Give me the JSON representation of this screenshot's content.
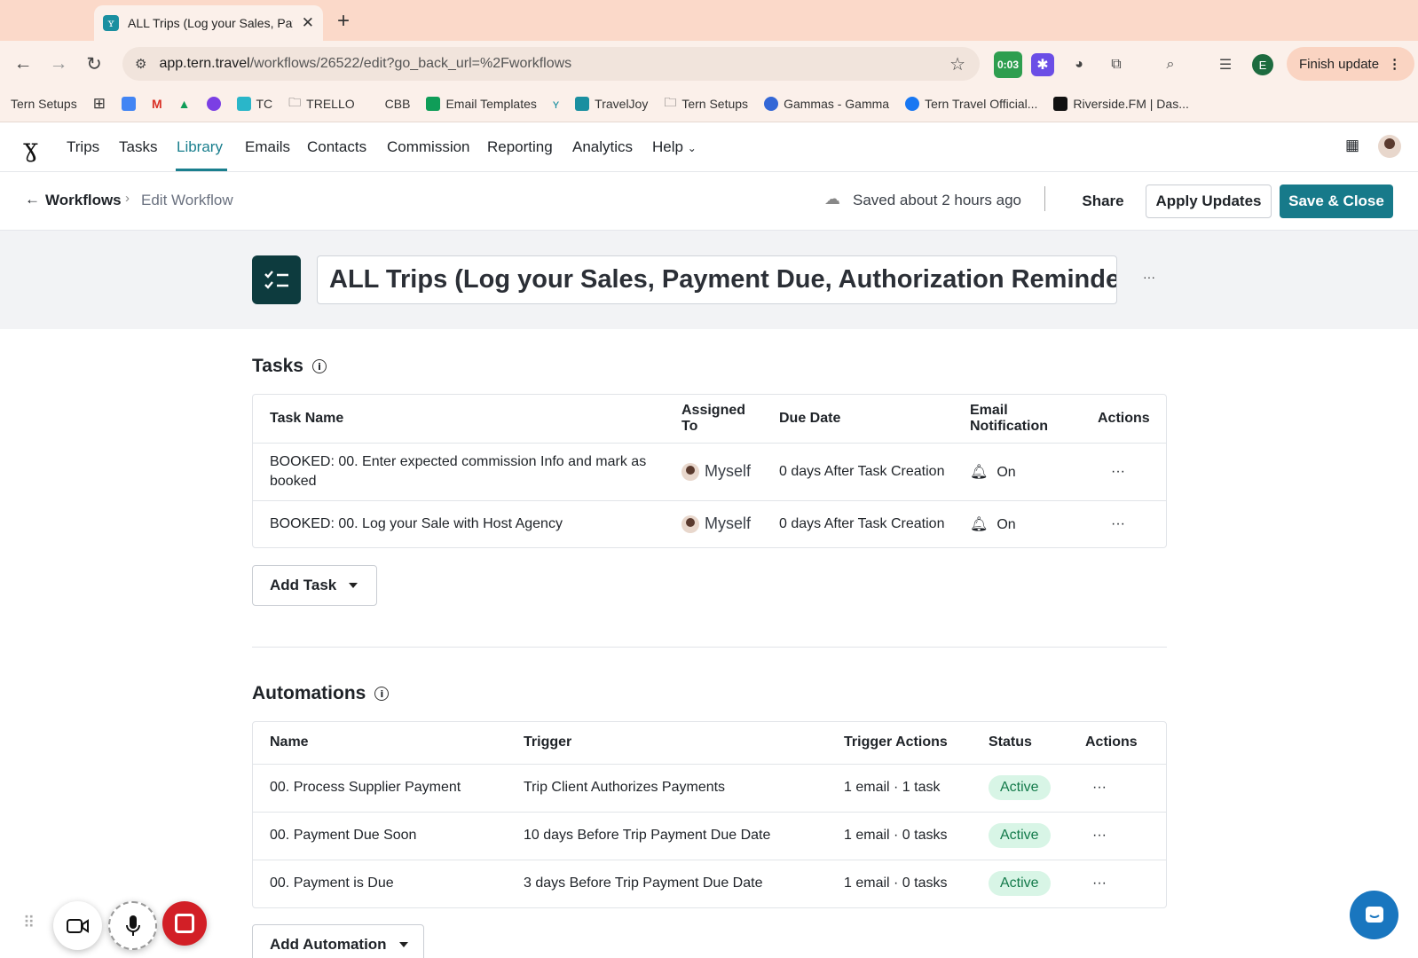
{
  "browser": {
    "tab_title": "ALL Trips (Log your Sales, Pay",
    "url_host": "app.tern.travel",
    "url_path": "/workflows/26522/edit?go_back_url=%2Fworkflows",
    "ext_timer": "0:03",
    "finish_update": "Finish update",
    "profile_initial": "E",
    "bookmarks": [
      "Tern Setups",
      "TC",
      "TRELLO",
      "CBB",
      "Email Templates",
      "TravelJoy",
      "Tern Setups",
      "Gammas - Gamma",
      "Tern Travel Official...",
      "Riverside.FM | Das..."
    ]
  },
  "nav": {
    "items": [
      "Trips",
      "Tasks",
      "Library",
      "Emails",
      "Contacts",
      "Commission",
      "Reporting",
      "Analytics",
      "Help"
    ],
    "active": "Library"
  },
  "subheader": {
    "back_label": "Workflows",
    "current": "Edit Workflow",
    "saved_status": "Saved about 2 hours ago",
    "share": "Share",
    "apply": "Apply Updates",
    "save_close": "Save & Close"
  },
  "workflow_title": "ALL Trips (Log your Sales, Payment Due, Authorization Reminders)",
  "more_glyph": "···",
  "tasks": {
    "heading": "Tasks",
    "columns": [
      "Task Name",
      "Assigned To",
      "Due Date",
      "Email Notification",
      "Actions"
    ],
    "rows": [
      {
        "name": "BOOKED: 00. Enter expected commission Info and mark as booked",
        "assigned": "Myself",
        "due": "0 days After Task Creation",
        "notification": "On"
      },
      {
        "name": "BOOKED: 00. Log your Sale with Host Agency",
        "assigned": "Myself",
        "due": "0 days After Task Creation",
        "notification": "On"
      }
    ],
    "add_label": "Add Task"
  },
  "automations": {
    "heading": "Automations",
    "columns": [
      "Name",
      "Trigger",
      "Trigger Actions",
      "Status",
      "Actions"
    ],
    "rows": [
      {
        "name": "00. Process Supplier Payment",
        "trigger": "Trip Client Authorizes Payments",
        "actions": "1 email · 1 task",
        "status": "Active"
      },
      {
        "name": "00. Payment Due Soon",
        "trigger": "10 days Before Trip Payment Due Date",
        "actions": "1 email · 0 tasks",
        "status": "Active"
      },
      {
        "name": "00. Payment is Due",
        "trigger": "3 days Before Trip Payment Due Date",
        "actions": "1 email · 0 tasks",
        "status": "Active"
      }
    ],
    "add_label": "Add Automation"
  },
  "colors": {
    "accent": "#1a7f8e",
    "save_button": "#177a8a",
    "icon_tile": "#0d3b3e",
    "badge_bg": "#d8f5e6",
    "badge_fg": "#137a4a",
    "chat": "#1976bf",
    "record": "#d21f26"
  }
}
